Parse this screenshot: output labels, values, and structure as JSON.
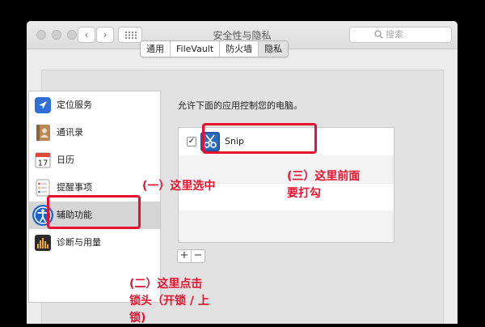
{
  "window": {
    "title": "安全性与隐私",
    "search_placeholder": "搜索"
  },
  "nav": {
    "back": "‹",
    "forward": "›"
  },
  "tabs": [
    {
      "label": "通用",
      "active": false
    },
    {
      "label": "FileVault",
      "active": false
    },
    {
      "label": "防火墙",
      "active": false
    },
    {
      "label": "隐私",
      "active": true
    }
  ],
  "sidebar": {
    "items": [
      {
        "label": "定位服务",
        "icon": "location-icon"
      },
      {
        "label": "通讯录",
        "icon": "contacts-icon"
      },
      {
        "label": "日历",
        "icon": "calendar-icon",
        "badge": "17"
      },
      {
        "label": "提醒事项",
        "icon": "reminders-icon"
      },
      {
        "label": "辅助功能",
        "icon": "accessibility-icon",
        "selected": true
      },
      {
        "label": "诊断与用量",
        "icon": "diagnostics-icon"
      }
    ]
  },
  "main": {
    "description": "允许下面的应用控制您的电脑。",
    "apps": [
      {
        "name": "Snip",
        "checked": true,
        "check_glyph": "✓"
      }
    ],
    "add_label": "+",
    "remove_label": "−"
  },
  "annotations": {
    "one": "(一）这里选中",
    "two_lines": [
      "(二）这里点击",
      "锁头（开锁 / 上",
      "锁)"
    ],
    "three_lines": [
      "(三）这里前面",
      "要打勾"
    ]
  },
  "colors": {
    "annotation": "#e8112d",
    "selection": "#d5d5d5",
    "accessibility_blue": "#1a63c9"
  }
}
